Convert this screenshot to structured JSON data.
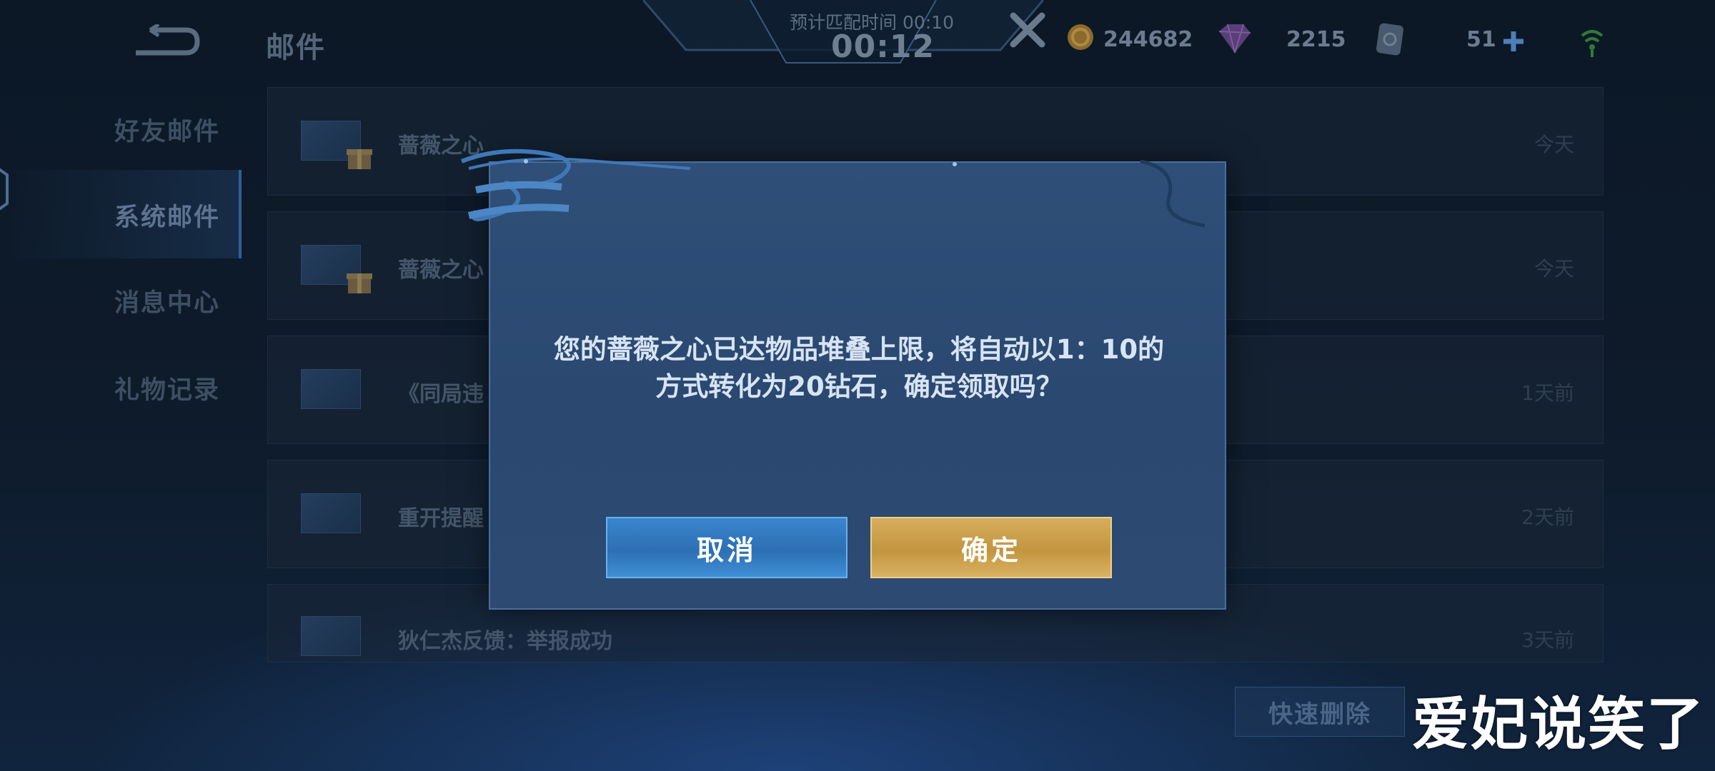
{
  "header": {
    "title": "邮件",
    "match_hint": "预计匹配时间 00:10",
    "match_timer": "00:12"
  },
  "resources": {
    "gold": "244682",
    "diamonds": "2215",
    "tickets": "51"
  },
  "sidebar": {
    "items": [
      {
        "label": "好友邮件"
      },
      {
        "label": "系统邮件",
        "active": true
      },
      {
        "label": "消息中心"
      },
      {
        "label": "礼物记录"
      }
    ]
  },
  "mail_list": [
    {
      "title": "蔷薇之心",
      "date": "今天",
      "gift": true
    },
    {
      "title": "蔷薇之心",
      "date": "今天",
      "gift": true
    },
    {
      "title": "《同局违",
      "date": "1天前",
      "gift": false
    },
    {
      "title": "重开提醒",
      "date": "2天前",
      "gift": false
    },
    {
      "title": "狄仁杰反馈：举报成功",
      "date": "3天前",
      "gift": false
    }
  ],
  "quick_delete_label": "快速删除",
  "dialog": {
    "message_line1": "您的蔷薇之心已达物品堆叠上限，将自动以1：10的",
    "message_line2": "方式转化为20钻石，确定领取吗？",
    "cancel_label": "取消",
    "confirm_label": "确定"
  },
  "watermark": "爱妃说笑了",
  "colors": {
    "cancel_button": "#2d6fb3",
    "confirm_button": "#c39540",
    "dialog_bg": "#2c4a72"
  }
}
